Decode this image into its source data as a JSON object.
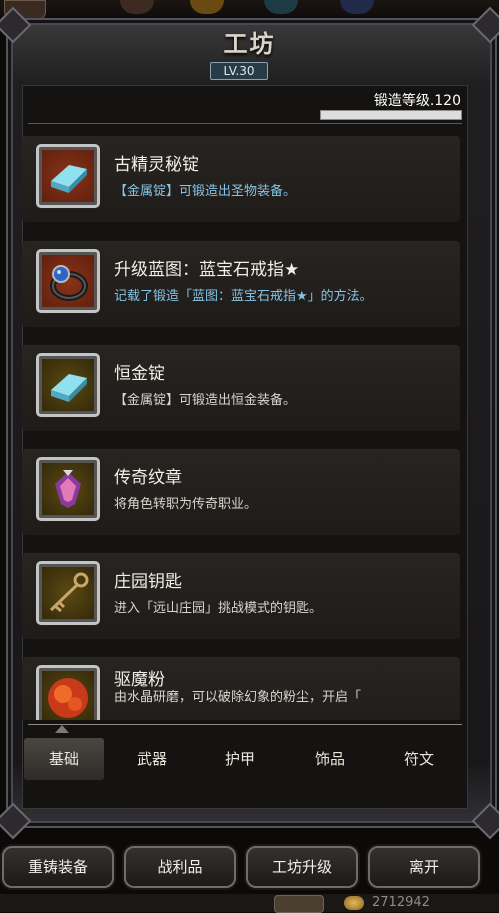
{
  "window": {
    "title": "工坊",
    "level_badge": "LV.30"
  },
  "forge": {
    "label": "锻造等级.120",
    "progress": 1.0
  },
  "items": [
    {
      "name": "古精灵秘锭",
      "desc": "【金属锭】可锻造出圣物装备。",
      "desc_style": "cyan",
      "frame": "red",
      "icon": "ingot-icon"
    },
    {
      "name": "升级蓝图：蓝宝石戒指★",
      "desc": "记载了锻造「蓝图：蓝宝石戒指★」的方法。",
      "desc_style": "cyan",
      "frame": "red",
      "icon": "ring-icon"
    },
    {
      "name": "恒金锭",
      "desc": "【金属锭】可锻造出恒金装备。",
      "desc_style": "white",
      "frame": "gold",
      "icon": "ingot-icon"
    },
    {
      "name": "传奇纹章",
      "desc": "将角色转职为传奇职业。",
      "desc_style": "white",
      "frame": "gold",
      "icon": "crest-icon"
    },
    {
      "name": "庄园钥匙",
      "desc": "进入「远山庄园」挑战模式的钥匙。",
      "desc_style": "white",
      "frame": "gold",
      "icon": "key-icon"
    },
    {
      "name": "驱魔粉",
      "desc": "由水晶研磨，可以破除幻象的粉尘，开启「",
      "desc_style": "white",
      "frame": "gold",
      "icon": "powder-icon"
    }
  ],
  "tabs": [
    "基础",
    "武器",
    "护甲",
    "饰品",
    "符文"
  ],
  "active_tab": "基础",
  "buttons": {
    "recast": "重铸装备",
    "loot": "战利品",
    "upgrade": "工坊升级",
    "leave": "离开"
  },
  "status": {
    "gold": "2712942"
  }
}
